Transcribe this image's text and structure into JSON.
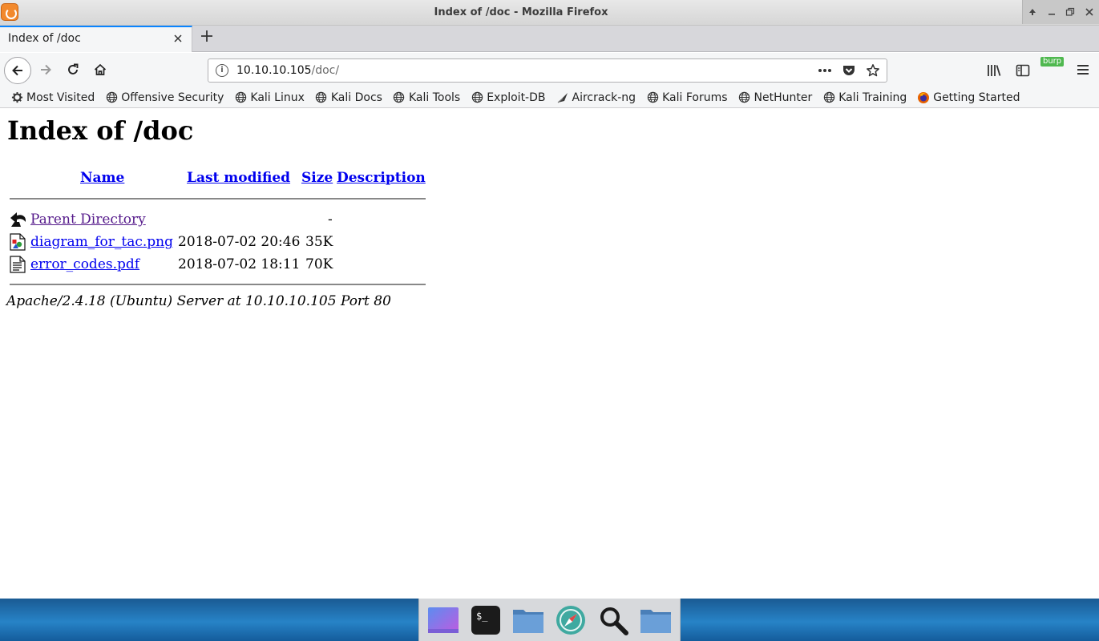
{
  "window": {
    "title": "Index of /doc - Mozilla Firefox",
    "controls": [
      "up-arrow",
      "minimize",
      "restore",
      "close"
    ]
  },
  "tabs": [
    {
      "label": "Index of /doc",
      "active": true
    }
  ],
  "navbar": {
    "url_host": "10.10.10.105",
    "url_path": "/doc/",
    "extension_badge": "burp"
  },
  "bookmarks": [
    {
      "label": "Most Visited",
      "icon": "gear-icon"
    },
    {
      "label": "Offensive Security",
      "icon": "globe-icon"
    },
    {
      "label": "Kali Linux",
      "icon": "globe-icon"
    },
    {
      "label": "Kali Docs",
      "icon": "globe-icon"
    },
    {
      "label": "Kali Tools",
      "icon": "globe-icon"
    },
    {
      "label": "Exploit-DB",
      "icon": "globe-icon"
    },
    {
      "label": "Aircrack-ng",
      "icon": "aircrack-icon"
    },
    {
      "label": "Kali Forums",
      "icon": "globe-icon"
    },
    {
      "label": "NetHunter",
      "icon": "globe-icon"
    },
    {
      "label": "Kali Training",
      "icon": "globe-icon"
    },
    {
      "label": "Getting Started",
      "icon": "firefox-icon"
    }
  ],
  "page": {
    "heading": "Index of /doc",
    "columns": {
      "name": "Name",
      "last_modified": "Last modified",
      "size": "Size",
      "description": "Description"
    },
    "rows": [
      {
        "name": "Parent Directory",
        "modified": "",
        "size": "-",
        "icon": "back-folder-icon"
      },
      {
        "name": "diagram_for_tac.png",
        "modified": "2018-07-02 20:46",
        "size": "35K",
        "icon": "image-file-icon"
      },
      {
        "name": "error_codes.pdf",
        "modified": "2018-07-02 18:11",
        "size": "70K",
        "icon": "text-file-icon"
      }
    ],
    "address": "Apache/2.4.18 (Ubuntu) Server at 10.10.10.105 Port 80"
  },
  "dock": [
    {
      "icon": "desktop-icon"
    },
    {
      "icon": "terminal-icon"
    },
    {
      "icon": "folder-icon"
    },
    {
      "icon": "browser-compass-icon"
    },
    {
      "icon": "magnifier-icon"
    },
    {
      "icon": "folder-icon"
    }
  ],
  "colors": {
    "link": "#0000ee",
    "visited_link": "#551a8b",
    "tab_accent": "#0a84ff",
    "burp_badge": "#4fb84f"
  }
}
